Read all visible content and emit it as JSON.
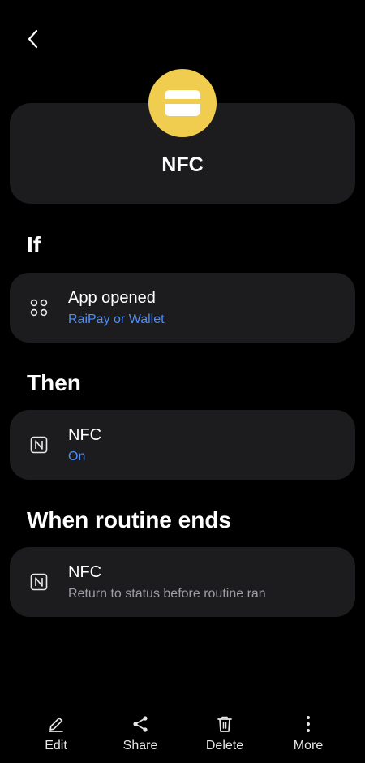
{
  "header": {
    "routine_name": "NFC",
    "icon": "card-icon",
    "icon_color": "#f0cd4f"
  },
  "sections": {
    "if_title": "If",
    "then_title": "Then",
    "ends_title": "When routine ends"
  },
  "if_condition": {
    "icon": "apps-icon",
    "title": "App opened",
    "subtitle": "RaiPay or Wallet"
  },
  "then_action": {
    "icon": "nfc-icon",
    "title": "NFC",
    "subtitle": "On"
  },
  "end_action": {
    "icon": "nfc-icon",
    "title": "NFC",
    "subtitle": "Return to status before routine ran"
  },
  "bottom_bar": {
    "edit": "Edit",
    "share": "Share",
    "delete": "Delete",
    "more": "More"
  },
  "colors": {
    "background": "#000000",
    "card": "#1c1c1e",
    "accent_blue": "#4f8cf5",
    "secondary_text": "#9e9ea4"
  }
}
